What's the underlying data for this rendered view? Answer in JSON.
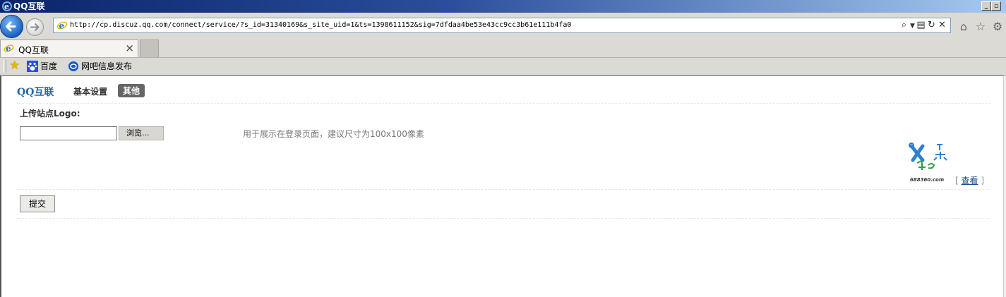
{
  "window": {
    "title": "QQ互联"
  },
  "address_bar": {
    "url": "http://cp.discuz.qq.com/connect/service/?s_id=31340169&s_site_uid=1&ts=1398611152&sig=7dfdaa4be53e43cc9cc3b61e111b4fa0"
  },
  "tabs": [
    {
      "label": "QQ互联",
      "close": "×"
    }
  ],
  "favorites": [
    {
      "label": "百度",
      "icon": "baidu-paw-icon"
    },
    {
      "label": "网吧信息发布",
      "icon": "globe-icon"
    }
  ],
  "page": {
    "brand": "QQ互联",
    "nav": [
      {
        "label": "基本设置"
      },
      {
        "label": "其他",
        "active": true
      }
    ],
    "upload_label": "上传站点Logo:",
    "browse_label": "浏览...",
    "hint": "用于展示在登录页面，建议尺寸为100x100像素",
    "view_open": "[",
    "view_link": "查看",
    "view_close": "]",
    "submit_label": "提交"
  },
  "colors": {
    "brand": "#2366a8",
    "active_tab_bg": "#666666",
    "title_bar": "#0a246a"
  }
}
